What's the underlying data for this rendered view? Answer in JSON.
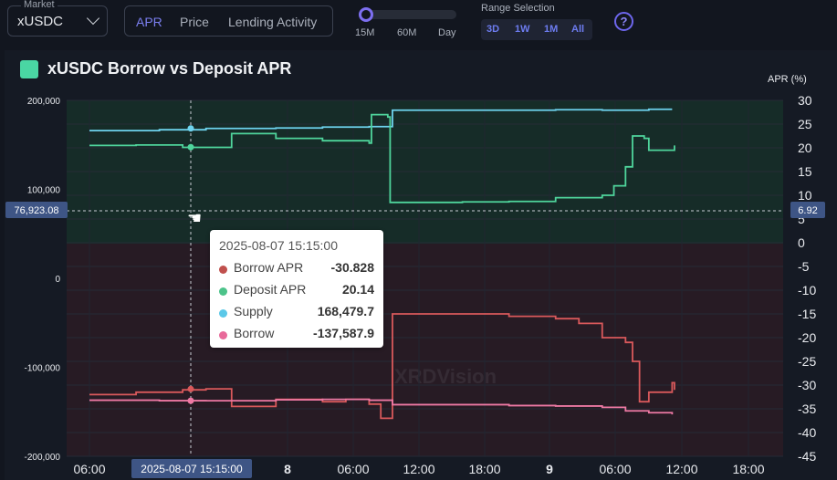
{
  "market": {
    "legend": "Market",
    "value": "xUSDC"
  },
  "tabs": [
    {
      "label": "APR"
    },
    {
      "label": "Price"
    },
    {
      "label": "Lending Activity"
    }
  ],
  "granularity": [
    "15M",
    "60M",
    "Day"
  ],
  "range": {
    "label": "Range Selection",
    "options": [
      "3D",
      "1W",
      "1M",
      "All"
    ]
  },
  "help": "?",
  "title": "xUSDC Borrow vs Deposit APR",
  "right_axis_title": "APR (%)",
  "crosshair": {
    "left_value": "76,923.08",
    "right_value": "6.92",
    "x_value": "2025-08-07 15:15:00"
  },
  "tooltip": {
    "time": "2025-08-07 15:15:00",
    "rows": [
      {
        "name": "Borrow APR",
        "value": "-30.828",
        "color": "#c0504d"
      },
      {
        "name": "Deposit APR",
        "value": "20.14",
        "color": "#4cc38a"
      },
      {
        "name": "Supply",
        "value": "168,479.7",
        "color": "#5bc8e8"
      },
      {
        "name": "Borrow",
        "value": "-137,587.9",
        "color": "#e86a9a"
      }
    ]
  },
  "watermark": "XRDVision",
  "colors": {
    "borrow_apr": "#d9595b",
    "deposit_apr": "#4fd59c",
    "supply": "#6ed3ee",
    "borrow": "#ee79a4",
    "accent": "#7b7ff0"
  },
  "chart_data": {
    "type": "line",
    "x_ticks": [
      "06:00",
      "8",
      "06:00",
      "12:00",
      "18:00",
      "9",
      "06:00",
      "12:00",
      "18:00"
    ],
    "left_axis": {
      "ticks": [
        "200,000",
        "100,000",
        "0",
        "-100,000",
        "-200,000"
      ],
      "range": [
        -200000,
        200000
      ]
    },
    "right_axis": {
      "label": "APR (%)",
      "ticks": [
        "30",
        "25",
        "20",
        "15",
        "10",
        "5",
        "0",
        "-5",
        "-10",
        "-15",
        "-20",
        "-25",
        "-30",
        "-35",
        "-40",
        "-45"
      ],
      "range": [
        -45,
        30
      ]
    },
    "series": [
      {
        "name": "Supply",
        "axis": "left",
        "points": [
          [
            0,
            166000
          ],
          [
            3,
            167000
          ],
          [
            5,
            168480
          ],
          [
            8,
            169000
          ],
          [
            10,
            170000
          ],
          [
            12,
            170500
          ],
          [
            13,
            189000
          ],
          [
            18,
            189000
          ],
          [
            20,
            189500
          ],
          [
            22,
            189000
          ],
          [
            24,
            190000
          ],
          [
            25,
            190000
          ]
        ]
      },
      {
        "name": "Deposit APR",
        "axis": "right",
        "points": [
          [
            0,
            20.5
          ],
          [
            2,
            20.6
          ],
          [
            4,
            20.1
          ],
          [
            5,
            20.1
          ],
          [
            6,
            20.1
          ],
          [
            6.1,
            23.0
          ],
          [
            8,
            22.0
          ],
          [
            10,
            21.5
          ],
          [
            12,
            21.0
          ],
          [
            12.1,
            27
          ],
          [
            12.8,
            26.5
          ],
          [
            12.9,
            8.5
          ],
          [
            16,
            8.6
          ],
          [
            18,
            8.7
          ],
          [
            20,
            9.5
          ],
          [
            22,
            10.0
          ],
          [
            22.5,
            12
          ],
          [
            23,
            16
          ],
          [
            23.3,
            22.5
          ],
          [
            23.8,
            22.0
          ],
          [
            24,
            19.5
          ],
          [
            25,
            19.5
          ],
          [
            25.1,
            20.5
          ]
        ]
      },
      {
        "name": "Borrow APR",
        "axis": "right",
        "points": [
          [
            0,
            -32.0
          ],
          [
            2,
            -31.5
          ],
          [
            4,
            -31.0
          ],
          [
            5,
            -30.8
          ],
          [
            6,
            -30.8
          ],
          [
            6.1,
            -34.5
          ],
          [
            8,
            -33.0
          ],
          [
            10,
            -33.5
          ],
          [
            11,
            -33.0
          ],
          [
            12,
            -34.0
          ],
          [
            12.5,
            -37
          ],
          [
            12.9,
            -37
          ],
          [
            13,
            -15
          ],
          [
            16,
            -15
          ],
          [
            18,
            -15.5
          ],
          [
            20,
            -16
          ],
          [
            21,
            -17
          ],
          [
            22,
            -20
          ],
          [
            23,
            -21
          ],
          [
            23.3,
            -25
          ],
          [
            23.6,
            -33.5
          ],
          [
            24,
            -31.5
          ],
          [
            25,
            -29.5
          ],
          [
            25.1,
            -31.0
          ]
        ]
      },
      {
        "name": "Borrow",
        "axis": "left",
        "points": [
          [
            0,
            -137000
          ],
          [
            3,
            -137500
          ],
          [
            5,
            -137588
          ],
          [
            8,
            -136500
          ],
          [
            10,
            -136000
          ],
          [
            12,
            -137000
          ],
          [
            13,
            -142000
          ],
          [
            18,
            -143000
          ],
          [
            20,
            -143500
          ],
          [
            22,
            -145000
          ],
          [
            23,
            -149000
          ],
          [
            24,
            -151000
          ],
          [
            25,
            -153000
          ]
        ]
      }
    ]
  }
}
